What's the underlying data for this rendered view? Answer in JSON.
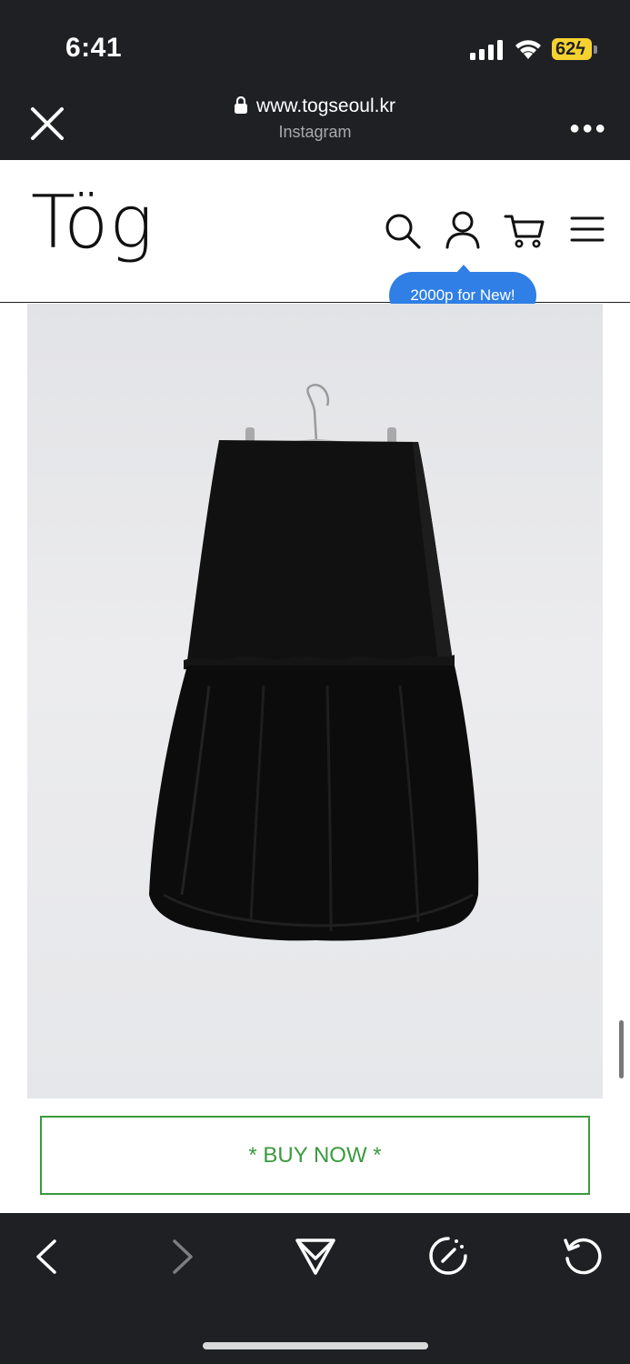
{
  "status_bar": {
    "time": "6:41",
    "battery_level": "62",
    "charging": true
  },
  "browser": {
    "url": "www.togseoul.kr",
    "source": "Instagram"
  },
  "site": {
    "logo": "Tög",
    "header_icons": [
      "search-icon",
      "account-icon",
      "cart-icon",
      "menu-icon"
    ],
    "promo_tooltip": "2000p for New!"
  },
  "product": {
    "image": "black-bubble-hem-skirt-on-hanger"
  },
  "cta": {
    "buy_label": "* BUY NOW *"
  },
  "toolbar": {
    "icons": [
      "back-icon",
      "forward-icon",
      "share-icon",
      "speed-icon",
      "reload-icon"
    ]
  },
  "colors": {
    "cta_green": "#3a9a3e",
    "tooltip_blue": "#2f7fe6",
    "battery_yellow": "#f5d230",
    "browser_chrome": "#1f2024"
  }
}
